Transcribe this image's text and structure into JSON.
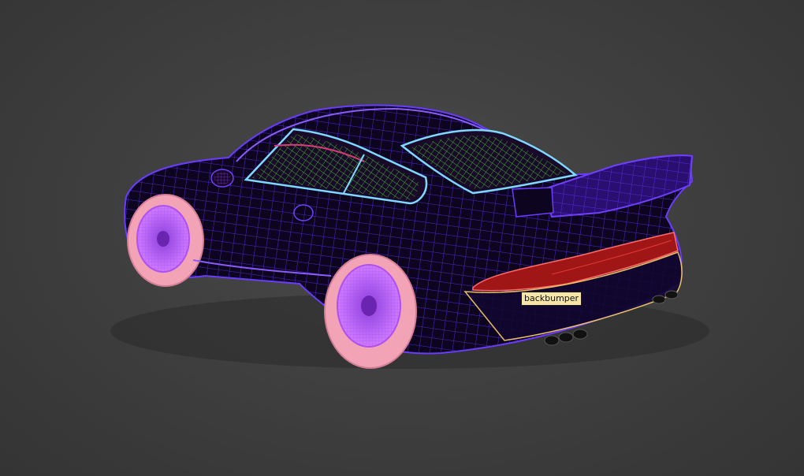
{
  "viewport": {
    "tooltip": "backbumper"
  },
  "colors": {
    "background": "#3b3b3b",
    "body_wire": "#5a2ee8",
    "body_fill": "#0d0520",
    "glass_edge": "#7fd8ff",
    "interior_wire": "#3fbf2a",
    "wheel_rim": "#c56bff",
    "tire": "#f2a4b6",
    "tail_light": "#b01818"
  }
}
